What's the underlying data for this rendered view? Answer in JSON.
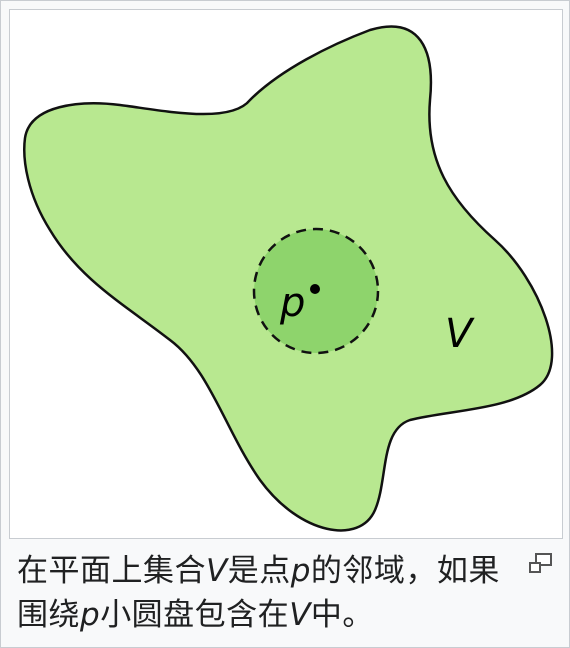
{
  "diagram": {
    "point_label": "p",
    "set_label": "V",
    "colors": {
      "set_fill": "#b8e890",
      "set_stroke": "#111111",
      "disk_fill": "#8ed46c",
      "disk_stroke": "#111111",
      "point": "#000000"
    }
  },
  "caption": {
    "seg1": "在平面上集合",
    "var_v1": "V",
    "seg2": "是点",
    "var_p1": "p",
    "seg3": "的邻域，如果围绕",
    "var_p2": "p",
    "seg4": "小圆盘包含在",
    "var_v2": "V",
    "seg5": "中。"
  },
  "magnify": {
    "icon": "magnify-clip-icon"
  }
}
